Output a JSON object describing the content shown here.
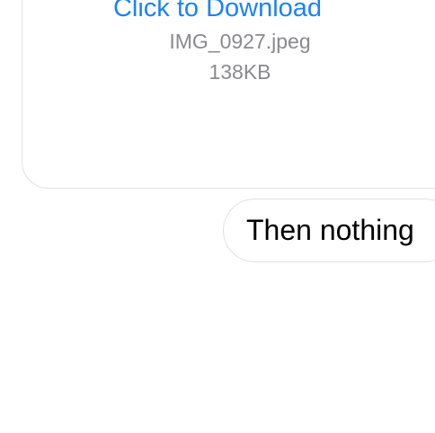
{
  "conversation": {
    "attachment": {
      "download_label": "Click to Download",
      "file_name": "IMG_0927.jpeg",
      "file_size": "138KB"
    },
    "messages": [
      {
        "text": "Then nothing"
      }
    ]
  },
  "colors": {
    "link": "#1a82fb",
    "secondary_text": "#8a8a8e",
    "bubble_border": "#e2e2e4",
    "background": "#ffffff"
  }
}
